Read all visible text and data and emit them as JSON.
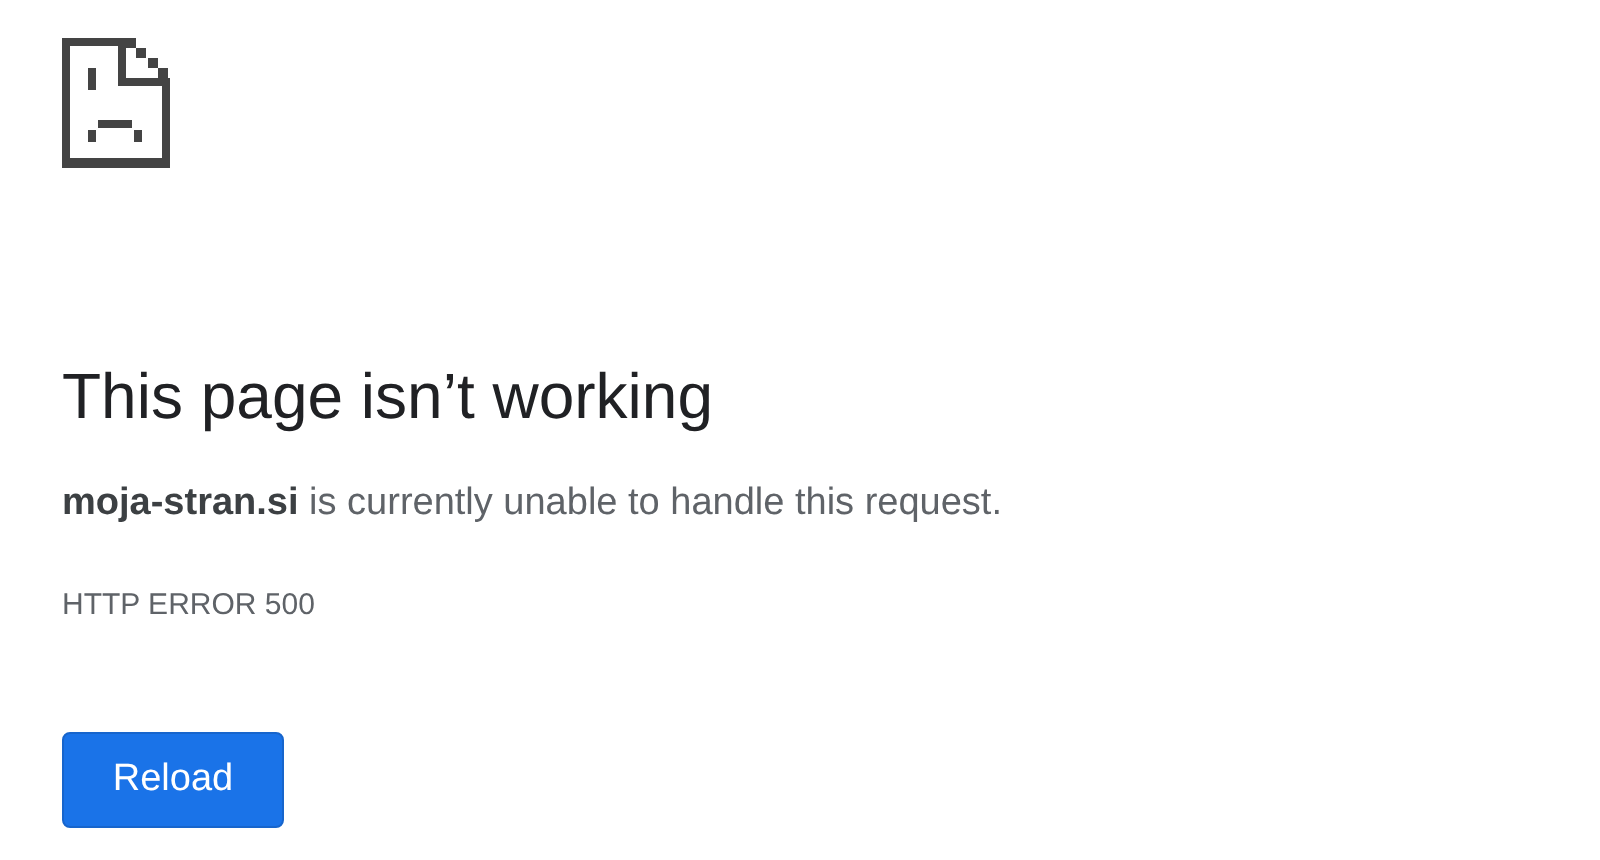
{
  "title": "This page isn’t working",
  "message": "**moja-stran.si** is currently unable to handle this request.",
  "error_code": "HTTP ERROR 500",
  "buttons": [
    "Reload"
  ]
}
